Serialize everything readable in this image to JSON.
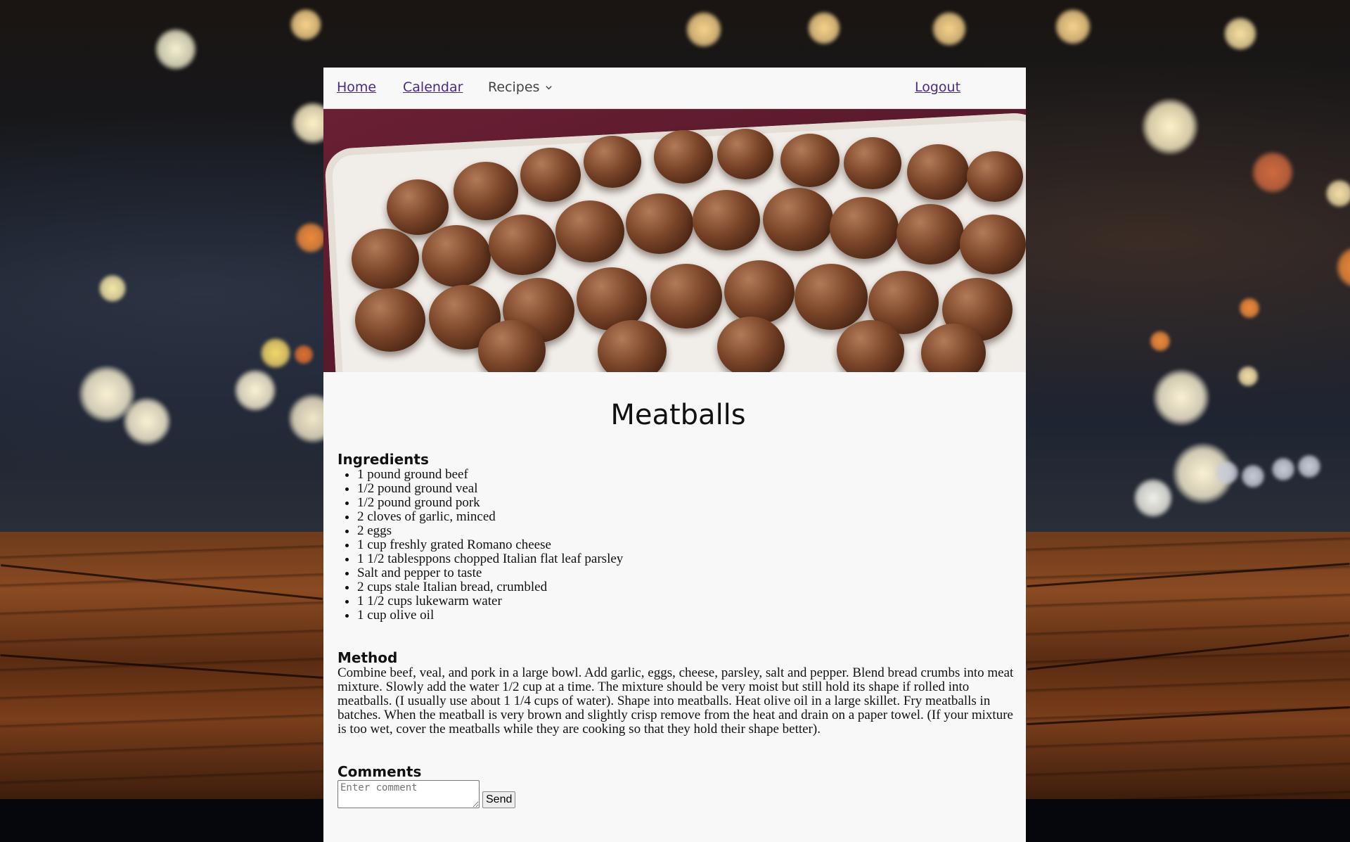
{
  "nav": {
    "home": "Home",
    "calendar": "Calendar",
    "recipes": "Recipes",
    "logout": "Logout"
  },
  "recipe": {
    "title": "Meatballs",
    "ingredients_heading": "Ingredients",
    "ingredients": [
      "1 pound ground beef",
      "1/2 pound ground veal",
      "1/2 pound ground pork",
      "2 cloves of garlic, minced",
      "2 eggs",
      "1 cup freshly grated Romano cheese",
      "1 1/2 tablesppons chopped Italian flat leaf parsley",
      "Salt and pepper to taste",
      "2 cups stale Italian bread, crumbled",
      "1 1/2 cups lukewarm water",
      "1 cup olive oil"
    ],
    "method_heading": "Method",
    "method": "Combine beef, veal, and pork in a large bowl. Add garlic, eggs, cheese, parsley, salt and pepper. Blend bread crumbs into meat mixture. Slowly add the water 1/2 cup at a time. The mixture should be very moist but still hold its shape if rolled into meatballs. (I usually use about 1 1/4 cups of water). Shape into meatballs. Heat olive oil in a large skillet. Fry meatballs in batches. When the meatball is very brown and slightly crisp remove from the heat and drain on a paper towel. (If your mixture is too wet, cover the meatballs while they are cooking so that they hold their shape better)."
  },
  "comments": {
    "heading": "Comments",
    "placeholder": "Enter comment",
    "value": "",
    "send_label": "Send"
  },
  "colors": {
    "link": "#4b2a86",
    "card_background": "#f8f8f8"
  },
  "icons": {
    "recipes_dropdown": "chevron-down-icon"
  }
}
